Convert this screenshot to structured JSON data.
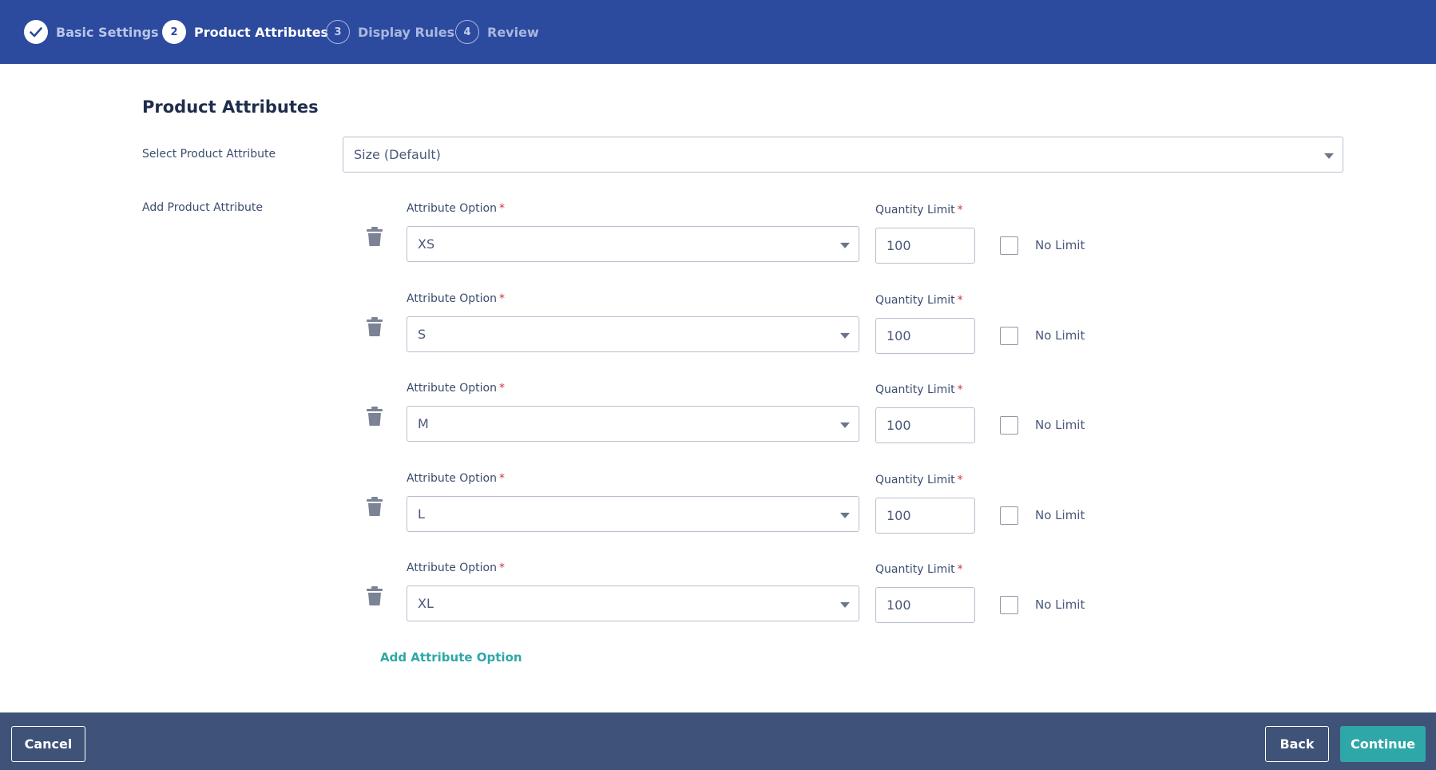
{
  "stepper": {
    "steps": [
      {
        "number": "",
        "label": "Basic Settings",
        "state": "done",
        "icon": "check-icon"
      },
      {
        "number": "2",
        "label": "Product Attributes",
        "state": "active"
      },
      {
        "number": "3",
        "label": "Display Rules",
        "state": "pending"
      },
      {
        "number": "4",
        "label": "Review",
        "state": "pending"
      }
    ]
  },
  "main": {
    "title": "Product Attributes",
    "select_attribute_label": "Select Product Attribute",
    "select_attribute_value": "Size (Default)",
    "add_attribute_label": "Add Product Attribute",
    "attribute_option_label": "Attribute Option",
    "quantity_limit_label": "Quantity Limit",
    "required_mark": "*",
    "no_limit_label": "No Limit",
    "rows": [
      {
        "option": "XS",
        "quantity": "100",
        "no_limit": false
      },
      {
        "option": "S",
        "quantity": "100",
        "no_limit": false
      },
      {
        "option": "M",
        "quantity": "100",
        "no_limit": false
      },
      {
        "option": "L",
        "quantity": "100",
        "no_limit": false
      },
      {
        "option": "XL",
        "quantity": "100",
        "no_limit": false
      }
    ],
    "add_option_link": "Add Attribute Option"
  },
  "footer": {
    "cancel_label": "Cancel",
    "back_label": "Back",
    "continue_label": "Continue"
  },
  "colors": {
    "header_bg": "#2c4a9e",
    "footer_bg": "#3f5378",
    "accent": "#2fa7a8",
    "required": "#d0343c"
  }
}
